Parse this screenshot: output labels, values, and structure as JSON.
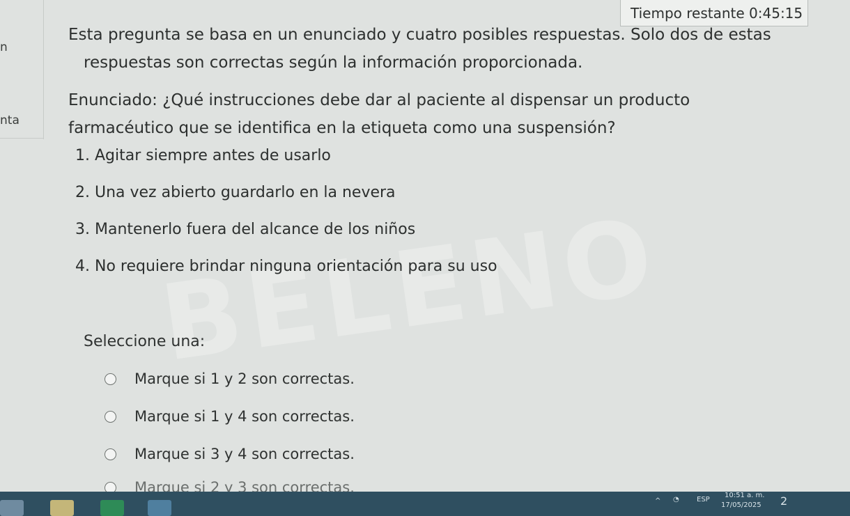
{
  "timer": {
    "label": "Tiempo restante",
    "value": "0:45:15"
  },
  "left_fragments": {
    "a": "n",
    "b": "nta"
  },
  "question": {
    "intro_line1": "Esta pregunta se basa en un enunciado y cuatro posibles respuestas. Solo dos de estas",
    "intro_line2": "respuestas son correctas según la información proporcionada.",
    "statement_line1": "Enunciado: ¿Qué instrucciones debe dar al paciente al dispensar un producto",
    "statement_line2": "farmacéutico que se identifica en la etiqueta como una suspensión?",
    "items": [
      "1. Agitar siempre antes de usarlo",
      "2. Una vez abierto guardarlo en la nevera",
      "3. Mantenerlo fuera del alcance de los niños",
      "4. No requiere brindar ninguna orientación para su uso"
    ]
  },
  "answers": {
    "select_label": "Seleccione una:",
    "options": [
      "Marque si 1 y 2 son correctas.",
      "Marque si 1 y 4 son correctas.",
      "Marque si 3 y 4 son correctas.",
      "Marque si 2 y 3 son correctas."
    ]
  },
  "taskbar": {
    "lang": "ESP",
    "time": "10:51 a. m.",
    "date": "17/05/2025",
    "notif_count": "2"
  },
  "colors": {
    "background": "#dfe2e0",
    "text": "#2d302f",
    "taskbar": "#2f4f60"
  }
}
